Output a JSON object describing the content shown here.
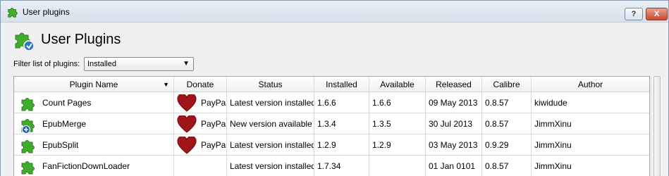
{
  "window": {
    "title": "User plugins",
    "help_label": "?",
    "close_label": "X"
  },
  "header": {
    "title": "User Plugins"
  },
  "filter": {
    "label": "Filter list of plugins:",
    "selected": "Installed"
  },
  "table": {
    "columns": [
      "Plugin Name",
      "Donate",
      "Status",
      "Installed",
      "Available",
      "Released",
      "Calibre",
      "Author"
    ],
    "rows": [
      {
        "name": "Count Pages",
        "icon": "puzzle-icon",
        "donate": "PayPal",
        "status": "Latest version installed",
        "installed": "1.6.6",
        "available": "1.6.6",
        "released": "09 May 2013",
        "calibre": "0.8.57",
        "author": "kiwidude"
      },
      {
        "name": "EpubMerge",
        "icon": "puzzle-update-icon",
        "donate": "PayPal",
        "status": "New version available",
        "installed": "1.3.4",
        "available": "1.3.5",
        "released": "30 Jul 2013",
        "calibre": "0.8.57",
        "author": "JimmXinu"
      },
      {
        "name": "EpubSplit",
        "icon": "puzzle-icon",
        "donate": "PayPal",
        "status": "Latest version installed",
        "installed": "1.2.9",
        "available": "1.2.9",
        "released": "03 May 2013",
        "calibre": "0.9.29",
        "author": "JimmXinu"
      },
      {
        "name": "FanFictionDownLoader",
        "icon": "puzzle-icon",
        "donate": "",
        "status": "Latest version installed",
        "installed": "1.7.34",
        "available": "",
        "released": "01 Jan 0101",
        "calibre": "0.8.57",
        "author": "JimmXinu"
      }
    ]
  },
  "colors": {
    "puzzle_green": "#3fae2a",
    "heart_red": "#a0151c",
    "update_badge": "#1f5fbf"
  }
}
